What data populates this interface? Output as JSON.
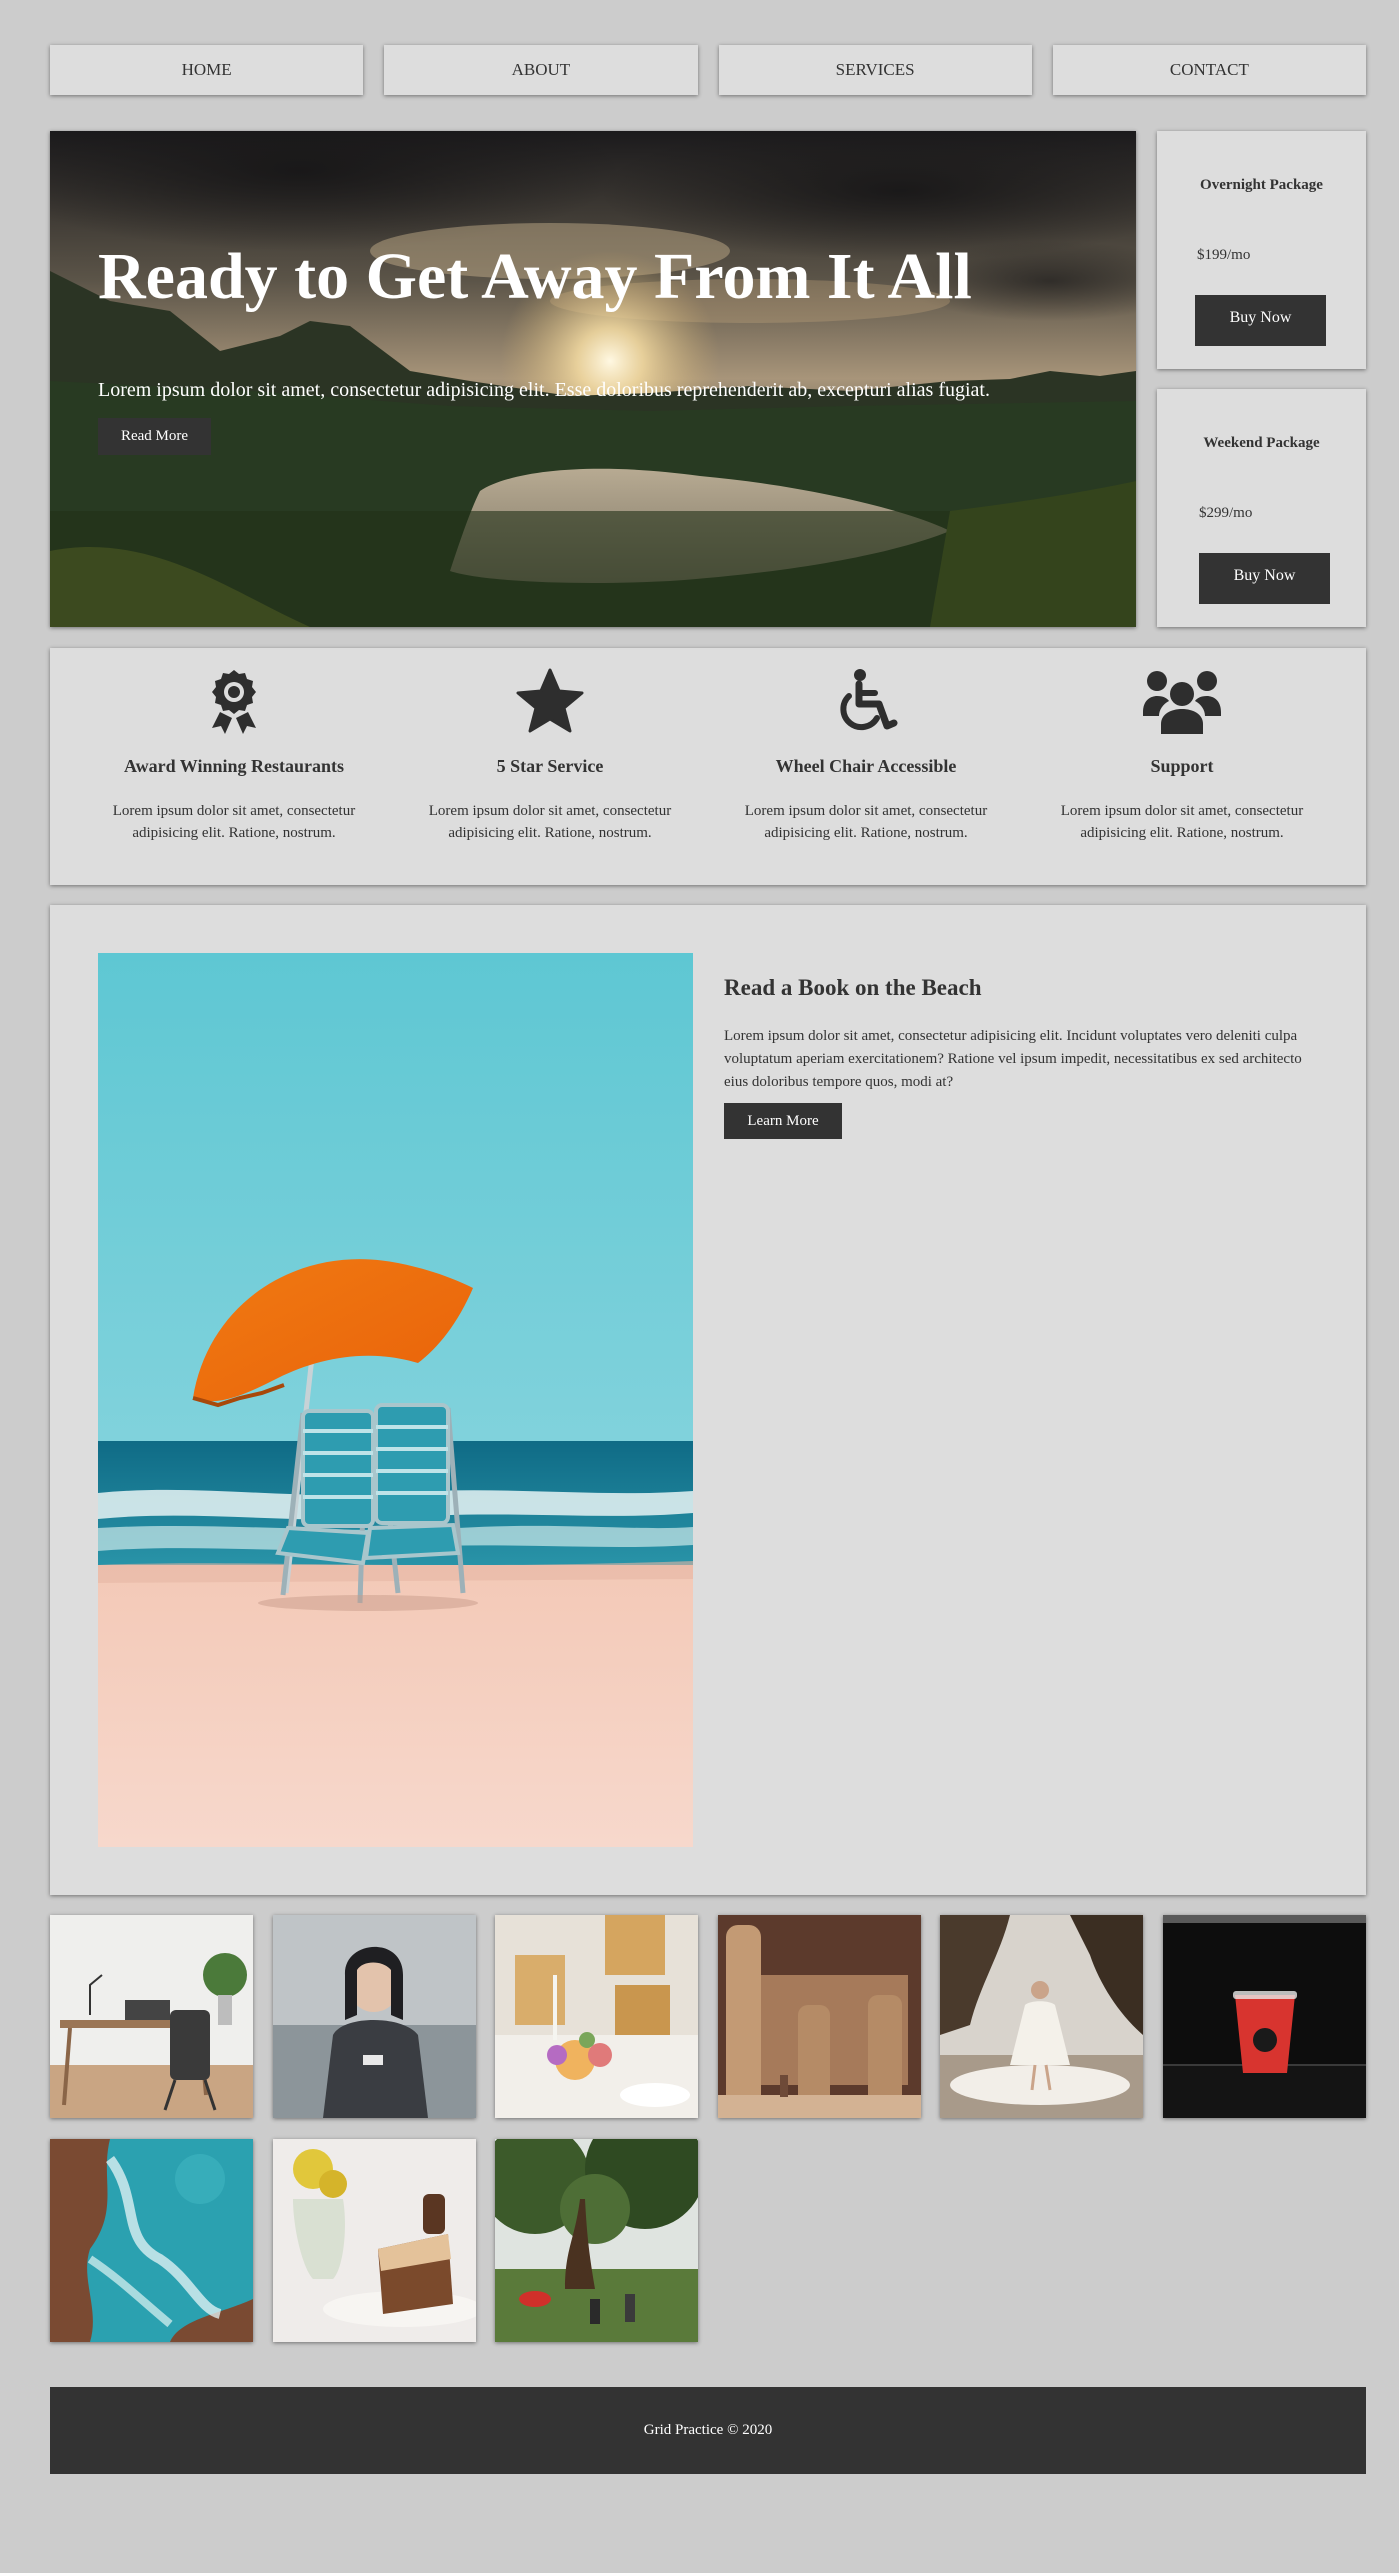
{
  "nav": {
    "items": [
      "HOME",
      "ABOUT",
      "SERVICES",
      "CONTACT"
    ]
  },
  "hero": {
    "title": "Ready to Get Away From It All",
    "text": "Lorem ipsum dolor sit amet, consectetur adipisicing elit. Esse doloribus reprehenderit ab, excepturi alias fugiat.",
    "button": "Read More"
  },
  "packages": [
    {
      "title": "Overnight Package",
      "price": "$199/mo",
      "button": "Buy Now"
    },
    {
      "title": "Weekend Package",
      "price": "$299/mo",
      "button": "Buy Now"
    }
  ],
  "features": [
    {
      "icon": "award-icon",
      "title": "Award Winning Restaurants",
      "text": "Lorem ipsum dolor sit amet, consectetur adipisicing elit. Ratione, nostrum."
    },
    {
      "icon": "star-icon",
      "title": "5 Star Service",
      "text": "Lorem ipsum dolor sit amet, consectetur adipisicing elit. Ratione, nostrum."
    },
    {
      "icon": "wheelchair-icon",
      "title": "Wheel Chair Accessible",
      "text": "Lorem ipsum dolor sit amet, consectetur adipisicing elit. Ratione, nostrum."
    },
    {
      "icon": "users-icon",
      "title": "Support",
      "text": "Lorem ipsum dolor sit amet, consectetur adipisicing elit. Ratione, nostrum."
    }
  ],
  "book": {
    "title": "Read a Book on the Beach",
    "text": "Lorem ipsum dolor sit amet, consectetur adipisicing elit. Incidunt voluptates vero deleniti culpa voluptatum aperiam exercitationem? Ratione vel ipsum impedit, necessitatibus ex sed architecto eius doloribus tempore quos, modi at?",
    "button": "Learn More"
  },
  "gallery": [
    "desk-photo",
    "person-photo",
    "dining-table-photo",
    "ruins-photo",
    "woman-in-dress-photo",
    "red-drink-photo",
    "ocean-rocks-photo",
    "cake-photo",
    "forest-picnic-photo"
  ],
  "footer": {
    "text": "Grid Practice © 2020"
  },
  "colors": {
    "page_bg": "#cccccc",
    "card_bg": "#dddddd",
    "dark": "#333333",
    "text": "#333333"
  }
}
